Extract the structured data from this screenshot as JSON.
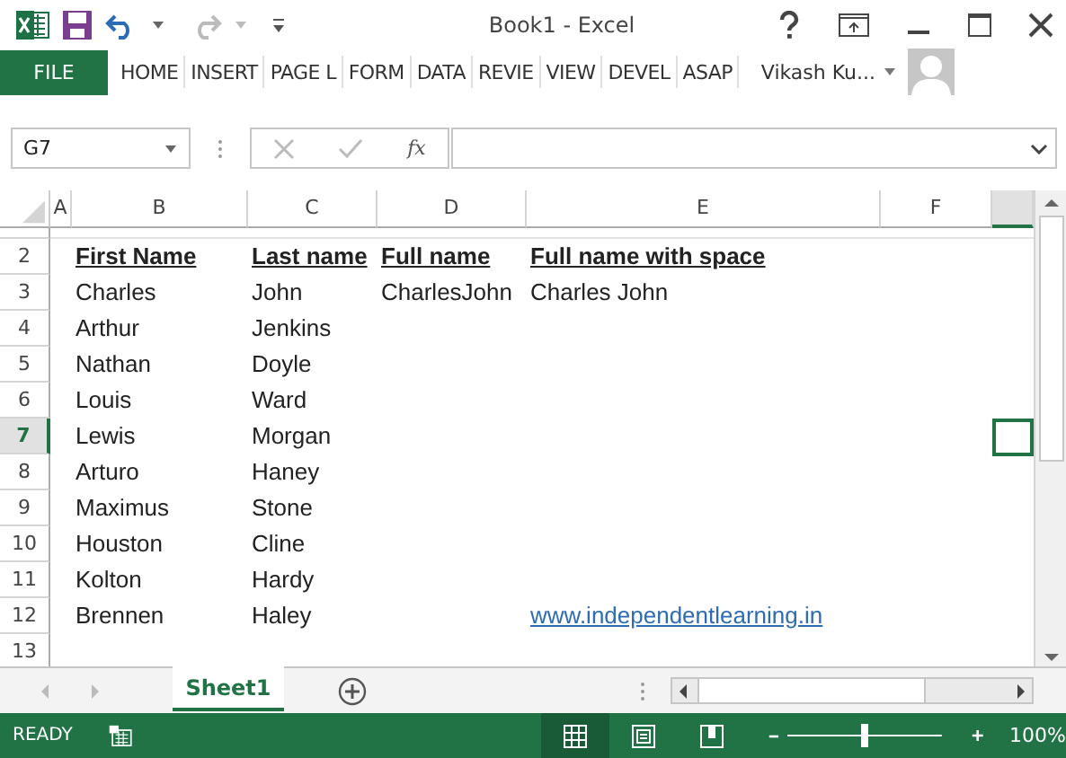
{
  "window": {
    "title": "Book1 - Excel"
  },
  "ribbon": {
    "file_tab": "FILE",
    "tabs": [
      {
        "label": "HOME",
        "selected": false
      },
      {
        "label": "INSERT",
        "selected": false
      },
      {
        "label": "PAGE L",
        "selected": false
      },
      {
        "label": "FORM",
        "selected": false
      },
      {
        "label": "DATA",
        "selected": false
      },
      {
        "label": "REVIE",
        "selected": false
      },
      {
        "label": "VIEW",
        "selected": false
      },
      {
        "label": "DEVEL",
        "selected": false
      },
      {
        "label": "ASAP",
        "selected": false
      }
    ],
    "user": "Vikash Ku..."
  },
  "formula_bar": {
    "name_box": "G7",
    "function_label": "fx"
  },
  "sheet": {
    "columns": [
      {
        "label": "A"
      },
      {
        "label": "B"
      },
      {
        "label": "C"
      },
      {
        "label": "D"
      },
      {
        "label": "E"
      },
      {
        "label": "F"
      }
    ],
    "partial_column": {
      "selected": true
    },
    "rows": [
      {
        "number": "2",
        "selected": false,
        "kind": "header",
        "cells": {
          "B": "First Name",
          "C": "Last name",
          "D": "Full name",
          "E": "Full name with space"
        }
      },
      {
        "number": "3",
        "selected": false,
        "kind": "data",
        "cells": {
          "B": "Charles",
          "C": "John",
          "D": "CharlesJohn",
          "E": "Charles John"
        }
      },
      {
        "number": "4",
        "selected": false,
        "kind": "data",
        "cells": {
          "B": "Arthur",
          "C": "Jenkins"
        }
      },
      {
        "number": "5",
        "selected": false,
        "kind": "data",
        "cells": {
          "B": "Nathan",
          "C": "Doyle"
        }
      },
      {
        "number": "6",
        "selected": false,
        "kind": "data",
        "cells": {
          "B": "Louis",
          "C": "Ward"
        }
      },
      {
        "number": "7",
        "selected": true,
        "kind": "data",
        "cells": {
          "B": "Lewis",
          "C": "Morgan"
        }
      },
      {
        "number": "8",
        "selected": false,
        "kind": "data",
        "cells": {
          "B": "Arturo",
          "C": "Haney"
        }
      },
      {
        "number": "9",
        "selected": false,
        "kind": "data",
        "cells": {
          "B": "Maximus",
          "C": "Stone"
        }
      },
      {
        "number": "10",
        "selected": false,
        "kind": "data",
        "cells": {
          "B": "Houston",
          "C": "Cline"
        }
      },
      {
        "number": "11",
        "selected": false,
        "kind": "data",
        "cells": {
          "B": "Kolton",
          "C": "Hardy"
        }
      },
      {
        "number": "12",
        "selected": false,
        "kind": "link",
        "cells": {
          "B": "Brennen",
          "C": "Haley",
          "E": "www.independentlearning.in"
        }
      },
      {
        "number": "13",
        "selected": false
      }
    ]
  },
  "sheet_tabs": [
    {
      "label": "Sheet1",
      "selected": true
    }
  ],
  "status_bar": {
    "status": "READY",
    "views": [
      {
        "selected": true
      },
      {
        "selected": false
      },
      {
        "selected": false
      }
    ],
    "zoom": {
      "level": 0.5,
      "reading": "100%"
    }
  }
}
